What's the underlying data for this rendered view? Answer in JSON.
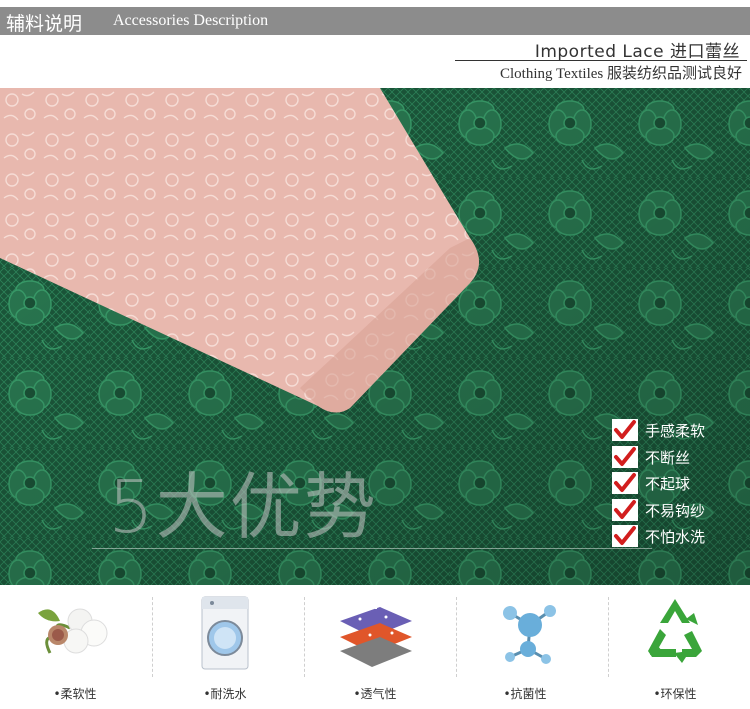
{
  "header": {
    "title_cn": "辅料说明",
    "title_en": "Accessories Description"
  },
  "subtitle": {
    "line1": "Imported Lace 进口蕾丝",
    "line2": "Clothing Textiles 服装纺织品测试良好"
  },
  "slogan": "5大优势",
  "benefits": [
    {
      "label": "手感柔软"
    },
    {
      "label": "不断丝"
    },
    {
      "label": "不起球"
    },
    {
      "label": "不易钩纱"
    },
    {
      "label": "不怕水洗"
    }
  ],
  "features": [
    {
      "label": "•柔软性",
      "icon": "cotton-icon"
    },
    {
      "label": "•耐洗水",
      "icon": "washing-machine-icon"
    },
    {
      "label": "•透气性",
      "icon": "breathable-layers-icon"
    },
    {
      "label": "•抗菌性",
      "icon": "molecule-icon"
    },
    {
      "label": "•环保性",
      "icon": "recycle-icon"
    }
  ],
  "colors": {
    "header_bg": "#8c8c8c",
    "lace_green": "#1d5e3f",
    "lace_pink": "#e9b9b0",
    "check_red": "#d21e1e",
    "recycle_green": "#3aa53a"
  }
}
